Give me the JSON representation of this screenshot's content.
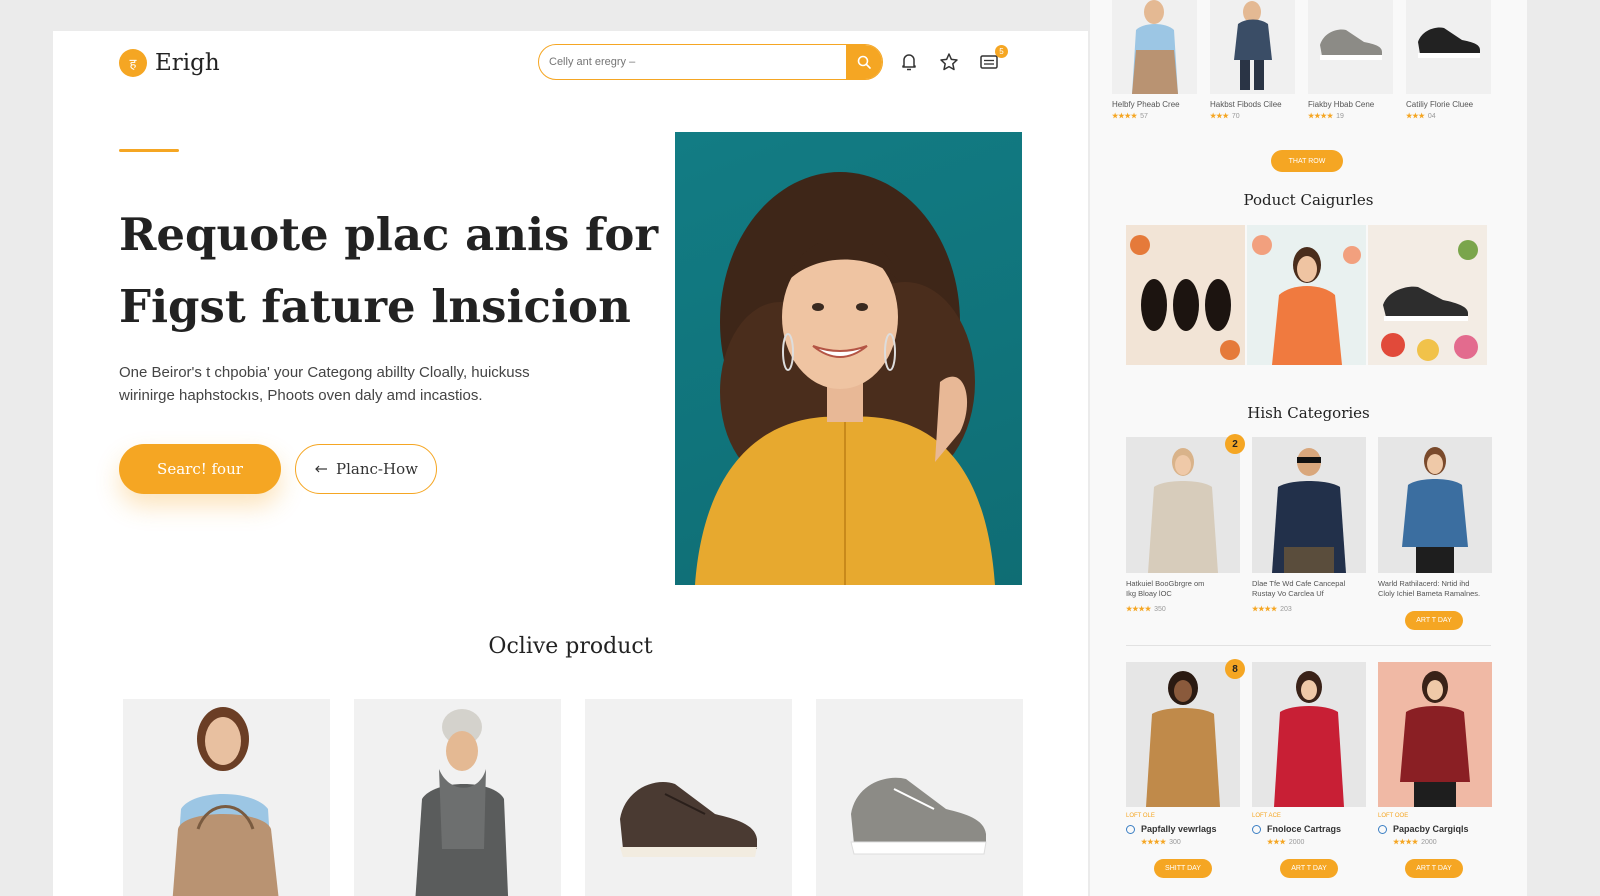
{
  "brand": {
    "name": "Erigh",
    "logo_glyph": "ह"
  },
  "search": {
    "placeholder": "Celly ant eregry –"
  },
  "header": {
    "cart_count": "5"
  },
  "hero": {
    "title_line1": "Requote plac anis for",
    "title_line2": "Figst fature lnsicion",
    "description_line1": "One Beiror's t chpobia' your Categong abillty Cloally, huickuss",
    "description_line2": "wirinirge haphstockıs, Phoots oven daly amd incastios.",
    "primary_button": "Searc! four",
    "secondary_button": "Planc-How"
  },
  "featured": {
    "title": "Oclive product"
  },
  "top_products": [
    {
      "name": "Helbfy Pheab Cree",
      "stars": "★★★★",
      "count": "57"
    },
    {
      "name": "Hakbst Fibods Cilee",
      "stars": "★★★",
      "count": "70"
    },
    {
      "name": "Fiakby Hbab Cene",
      "stars": "★★★★",
      "count": "19"
    },
    {
      "name": "Catiliy Florie Cluee",
      "stars": "★★★",
      "count": "04"
    }
  ],
  "top_button": "THAT ROW",
  "product_categories": {
    "title": "Poduct Caigurles"
  },
  "high_categories": {
    "title": "Hish Categories",
    "row1": [
      {
        "badge": "2",
        "text1": "Hatkuiel BooGbrgre om",
        "text2": "Ikg Bloay lOC",
        "stars": "★★★★",
        "count": "350"
      },
      {
        "badge": "",
        "text1": "Dlae Tfe Wd Cafe Cancepal",
        "text2": "Rustay Vo Carclea Uf",
        "stars": "★★★★",
        "count": "203"
      },
      {
        "badge": "",
        "text1": "Warld Rathilacerd: Nrtid ihd",
        "text2": "Cloly Ichiel Bameta Ramalnes.",
        "stars": "",
        "count": "",
        "button": "ART T DAY"
      }
    ],
    "row2": [
      {
        "badge": "8",
        "label": "LOFT OLE",
        "name": "Papfally vewrlags",
        "stars": "★★★★",
        "count": "300",
        "button": "SHITT DAY"
      },
      {
        "badge": "",
        "label": "LOFT ACE",
        "name": "Fnoloce Cartrags",
        "stars": "★★★",
        "count": "2000",
        "button": "ART T DAY"
      },
      {
        "badge": "",
        "label": "LOFT OOE",
        "name": "Papacby Cargiqls",
        "stars": "★★★★",
        "count": "2000",
        "button": "ART T DAY"
      }
    ]
  },
  "colors": {
    "accent": "#f5a623",
    "hero_bg": "#127c84",
    "radio": "#3b7fc4"
  }
}
